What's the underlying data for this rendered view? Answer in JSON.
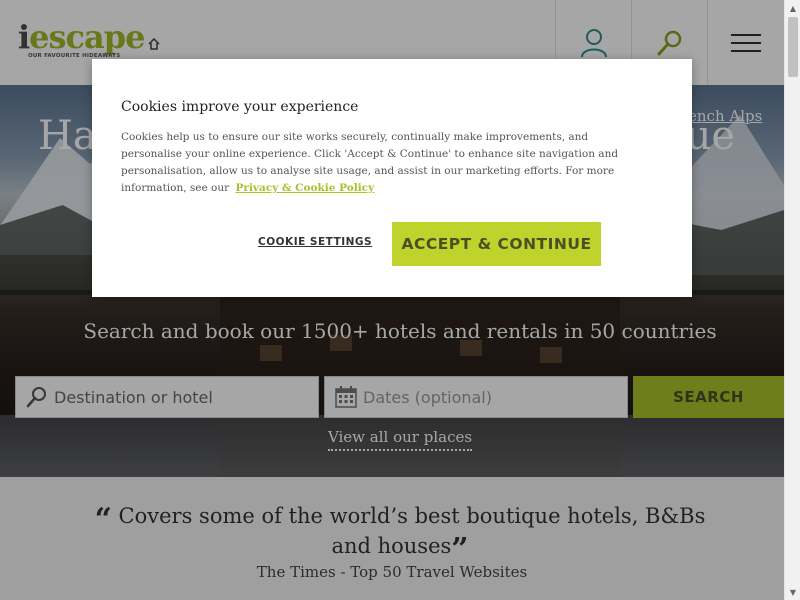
{
  "header": {
    "logo_main": "escape",
    "logo_i": "i",
    "logo_tagline": "OUR FAVOURITE HIDEAWAYS",
    "icons": {
      "account": "user-icon",
      "search": "magnifier-icon",
      "menu": "hamburger-icon"
    }
  },
  "hero": {
    "title_left": "Ha",
    "title_right": "que",
    "region_link": "ench Alps",
    "search_heading": "Search and book our 1500+ hotels and rentals in 50 countries",
    "destination_placeholder": "Destination or hotel",
    "dates_placeholder": "Dates (optional)",
    "search_button": "SEARCH",
    "view_all": "View all our places"
  },
  "review": {
    "quote": "Covers some of the world’s best boutique hotels, B&Bs and houses",
    "source": "The Times - Top 50 Travel Websites"
  },
  "cookie_modal": {
    "title": "Cookies improve your experience",
    "body": "Cookies help us to ensure our site works securely, continually make improvements, and personalise your online experience. Click 'Accept & Continue' to enhance site navigation and personalisation, allow us to analyse site usage, and assist in our marketing efforts. For more information, see our",
    "policy_link": "Privacy & Cookie Policy",
    "settings_button": "COOKIE SETTINGS",
    "accept_button": "ACCEPT & CONTINUE"
  },
  "colors": {
    "brand_green": "#a9c22a",
    "accept_green": "#c0d22c",
    "account_icon": "#2e8f8a",
    "search_icon": "#8aa024"
  }
}
